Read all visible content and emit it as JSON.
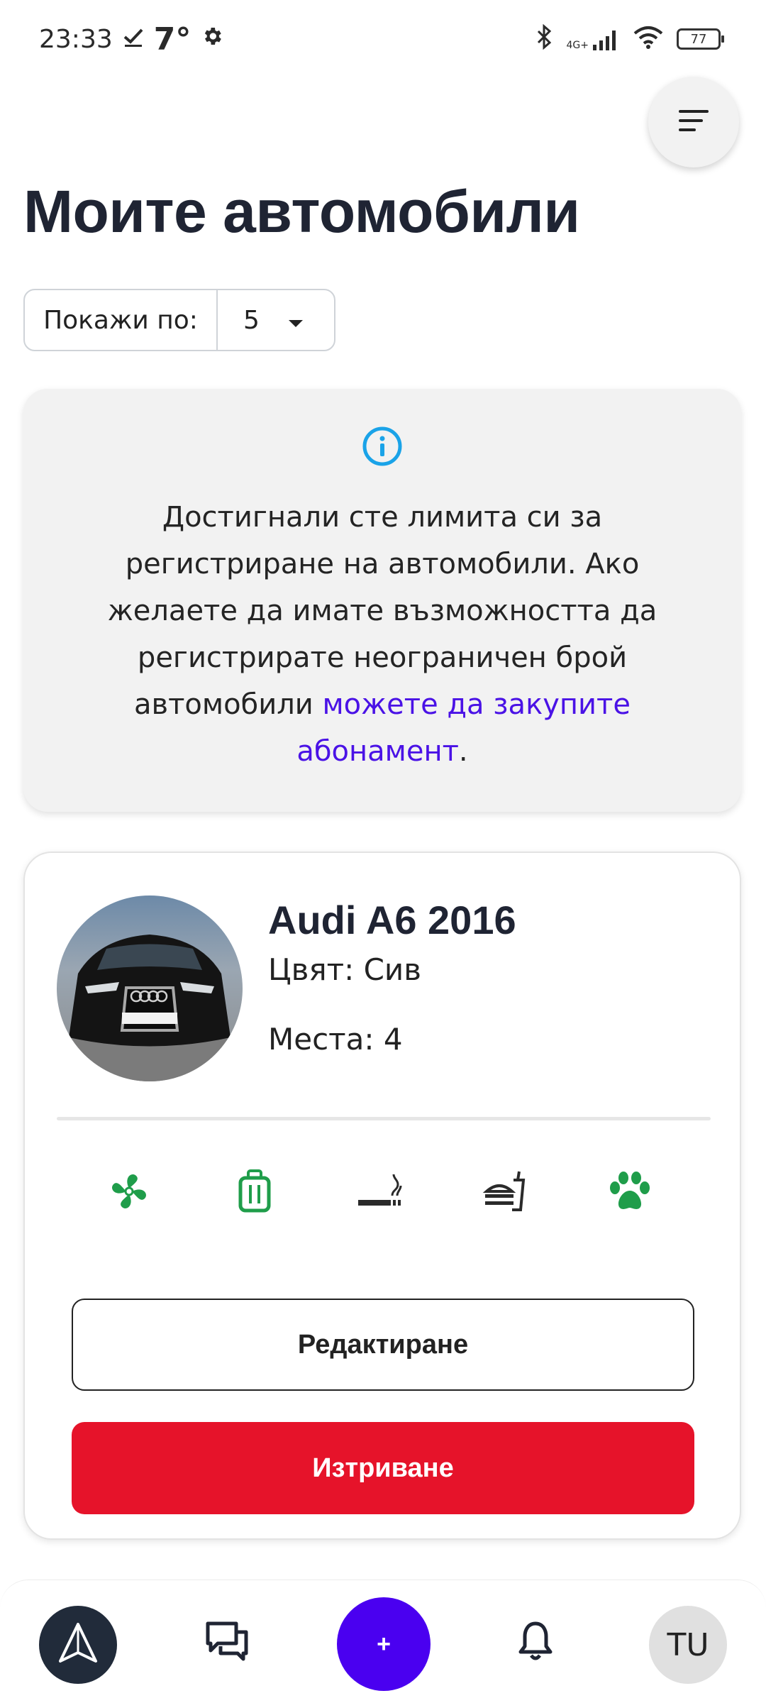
{
  "status_bar": {
    "time": "23:33",
    "temperature": "7°",
    "network": "4G+",
    "battery": "77"
  },
  "header": {
    "title": "Моите автомобили"
  },
  "show_per": {
    "label": "Покажи по:",
    "value": "5"
  },
  "info": {
    "text": "Достигнали сте лимита си за регистриране на автомобили. Ако желаете да имате възможността да регистрирате неограничен брой автомобили ",
    "link": "можете да закупите абонамент",
    "suffix": "."
  },
  "car": {
    "title": "Audi A6 2016",
    "color": "Цвят: Сив",
    "seats": "Места: 4",
    "features": [
      {
        "name": "air-conditioning-icon",
        "color": "#1f9d4a"
      },
      {
        "name": "luggage-icon",
        "color": "#1f9d4a"
      },
      {
        "name": "smoking-icon",
        "color": "#2a2a2a"
      },
      {
        "name": "food-icon",
        "color": "#2a2a2a"
      },
      {
        "name": "pets-icon",
        "color": "#1f9d4a"
      }
    ],
    "edit_label": "Редактиране",
    "delete_label": "Изтриване"
  },
  "bottom_nav": {
    "add_label": "+",
    "avatar_initials": "TU"
  },
  "colors": {
    "accent": "#4a00f0",
    "danger": "#e6132a",
    "success": "#1f9d4a",
    "info_blue": "#1aa3e8",
    "dark": "#212b3a"
  }
}
